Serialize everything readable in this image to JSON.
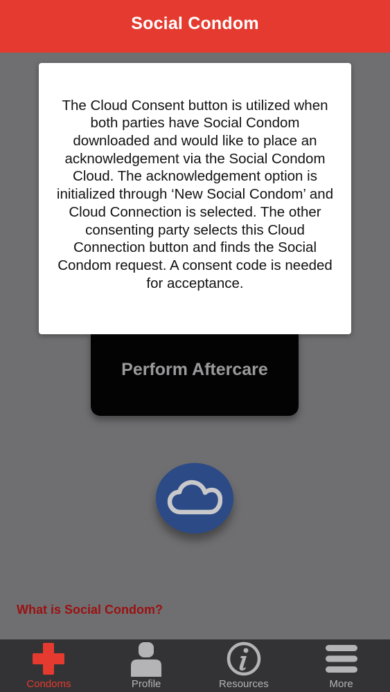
{
  "header": {
    "title": "Social Condom"
  },
  "main": {
    "aftercare_label": "Perform Aftercare",
    "what_is_link": "What is Social Condom?"
  },
  "modal": {
    "text": "The Cloud Consent button is utilized when both parties have Social Condom downloaded and would like to place an acknowledgement via the Social Condom Cloud. The acknowledgement option is initialized through ‘New Social Condom’ and Cloud Connection is selected. The other consenting party selects this Cloud Connection button and finds the Social Condom request. A consent code is needed for acceptance."
  },
  "tabbar": {
    "items": [
      {
        "label": "Condoms",
        "icon": "red-cross-icon",
        "active": true
      },
      {
        "label": "Profile",
        "icon": "person-icon",
        "active": false
      },
      {
        "label": "Resources",
        "icon": "info-icon",
        "active": false
      },
      {
        "label": "More",
        "icon": "hamburger-icon",
        "active": false
      }
    ]
  },
  "colors": {
    "header": "#e53a2f",
    "background": "#6f6f71",
    "tabbar": "#333335",
    "active_tab": "#e53a2f",
    "link": "#9b1111",
    "cloud_button": "#2b4a86"
  }
}
